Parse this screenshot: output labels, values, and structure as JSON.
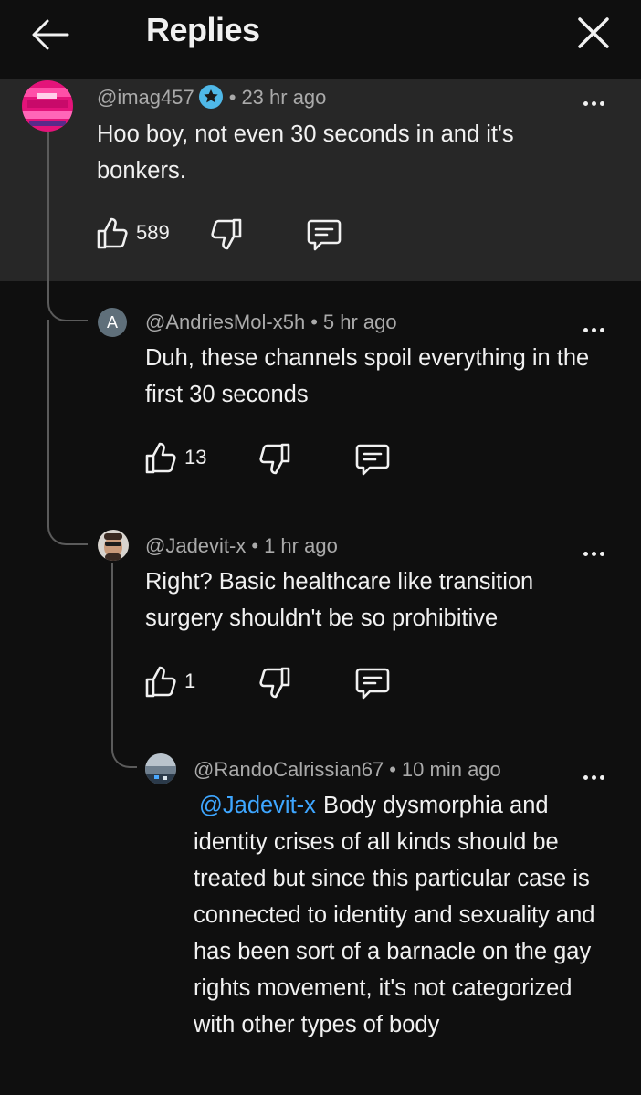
{
  "header": {
    "title": "Replies"
  },
  "parent_comment": {
    "handle": "@imag457",
    "time": "23 hr ago",
    "text": "Hoo boy, not even 30 seconds in and it's bonkers.",
    "likes": "589"
  },
  "replies": [
    {
      "avatar_letter": "A",
      "handle": "@AndriesMol-x5h",
      "time": "5 hr ago",
      "text": "Duh, these channels spoil everything in the first 30 seconds",
      "likes": "13"
    },
    {
      "handle": "@Jadevit-x",
      "time": "1 hr ago",
      "text": "Right? Basic healthcare like transition surgery shouldn't be so prohibitive",
      "likes": "1"
    },
    {
      "handle": "@RandoCalrissian67",
      "time": "10 min ago",
      "mention": "@Jadevit-x",
      "text": "Body dysmorphia and identity crises of all kinds should be treated but since this particular case is connected to identity and sexuality and has been sort of a barnacle on the gay rights movement, it's not categorized with other types of body"
    }
  ],
  "separator": "•",
  "colors": {
    "mention": "#3ea6ff",
    "verified_badge": "#4fb8e8"
  }
}
